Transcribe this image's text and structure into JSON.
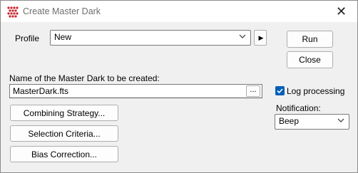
{
  "window": {
    "title": "Create Master Dark",
    "close_glyph": "✕"
  },
  "profile": {
    "label": "Profile",
    "value": "New",
    "play_glyph": "▶"
  },
  "actions": {
    "run_label": "Run",
    "close_label": "Close"
  },
  "master": {
    "label": "Name of the Master Dark to be created:",
    "value": "MasterDark.fts",
    "browse_label": "..."
  },
  "options": {
    "log_label": "Log processing",
    "log_checked": true,
    "notification_label": "Notification:",
    "notification_value": "Beep"
  },
  "buttons": {
    "combining": "Combining Strategy...",
    "selection": "Selection Criteria...",
    "bias": "Bias Correction..."
  },
  "colors": {
    "accent": "#005fb8",
    "icon_red": "#c8262e"
  }
}
